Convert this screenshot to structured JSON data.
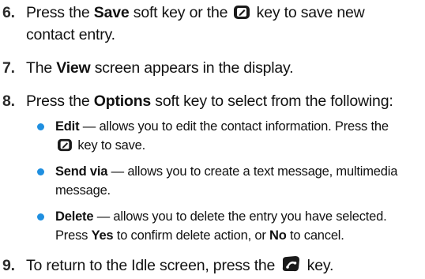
{
  "steps": [
    {
      "num": "6.",
      "pre": "Press the ",
      "bold": "Save",
      "mid": " soft key or the ",
      "key": "ok-key-icon",
      "post": " key to save new",
      "line2": "contact entry."
    },
    {
      "num": "7.",
      "pre": "The ",
      "bold": "View",
      "post": " screen appears in the display."
    },
    {
      "num": "8.",
      "pre": "Press the ",
      "bold": "Options",
      "post": " soft key to select from the following:"
    },
    {
      "num": "9.",
      "pre": "To return to the Idle screen, press the ",
      "key": "end-key-icon",
      "post": " key."
    }
  ],
  "options": [
    {
      "bold": "Edit",
      "dash": " — allows you to edit the contact information. Press the",
      "line2_post": " key to save.",
      "key": "ok-key-icon"
    },
    {
      "bold": "Send via",
      "dash": " — allows you to create a text message, multimedia",
      "line2": "message."
    },
    {
      "bold": "Delete",
      "dash": " — allows you to delete the entry you have selected.",
      "line2_pre": "Press ",
      "line2_bold1": "Yes",
      "line2_mid": " to confirm delete action, or ",
      "line2_bold2": "No",
      "line2_post": " to cancel."
    }
  ],
  "colors": {
    "bullet": "#1f8fe0",
    "text": "#111111"
  }
}
